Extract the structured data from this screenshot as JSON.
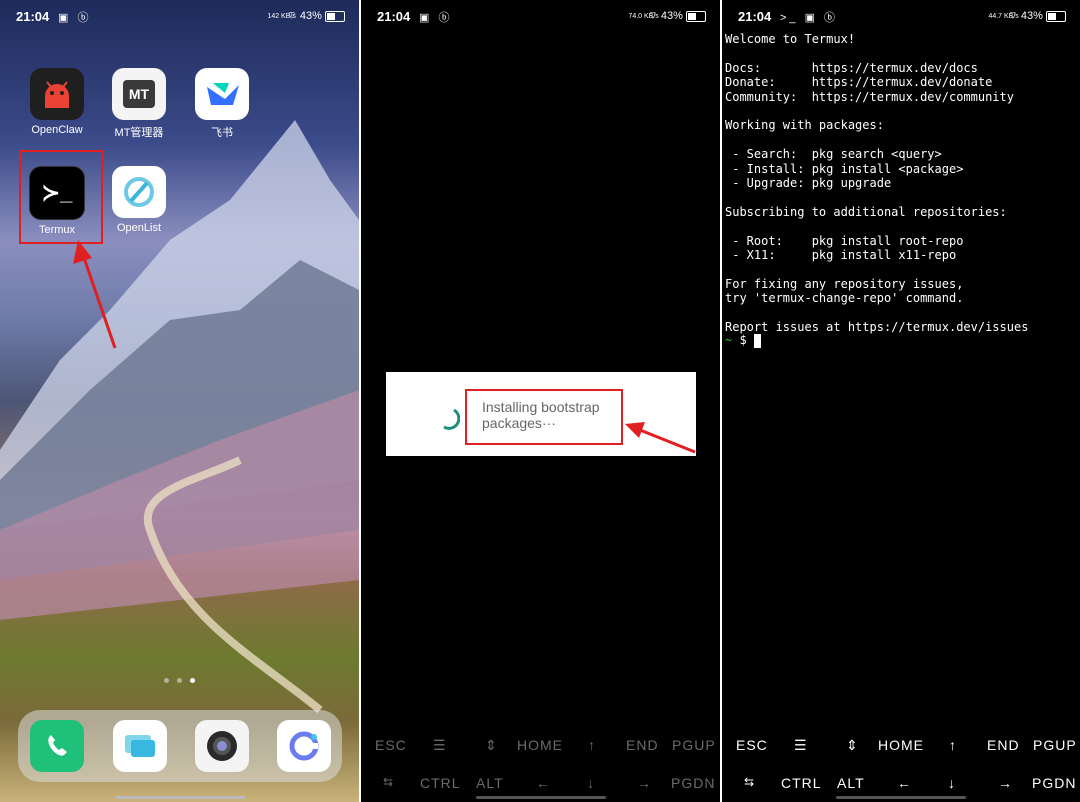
{
  "panel1": {
    "status": {
      "time": "21:04",
      "left_icons": "▣ ⓑ",
      "speed": "142 KB/s",
      "battery_pct": "43%"
    },
    "apps": [
      {
        "label": "OpenClaw",
        "icon": "android-robot-icon",
        "color": "#ea4335"
      },
      {
        "label": "MT管理器",
        "icon_text": "MT",
        "icon": "mt-manager-icon"
      },
      {
        "label": "飞书",
        "icon": "feishu-icon"
      },
      {
        "label": "Termux",
        "icon_text": "≻_",
        "icon": "terminal-icon"
      },
      {
        "label": "OpenList",
        "icon": "openlist-icon"
      }
    ],
    "page_dots": 3,
    "dock": [
      "phone-icon",
      "messages-icon",
      "camera-icon",
      "browser-icon"
    ]
  },
  "panel2": {
    "status": {
      "time": "21:04",
      "left_icons": "▣ ⓑ",
      "speed": "74.0 KB/s",
      "battery_pct": "43%"
    },
    "dialog_message": "Installing bootstrap packages···",
    "keys_row1": [
      "ESC",
      "☰",
      "⇕",
      "HOME",
      "↑",
      "END",
      "PGUP"
    ],
    "keys_row2": [
      "⇆",
      "CTRL",
      "ALT",
      "←",
      "↓",
      "→",
      "PGDN"
    ]
  },
  "panel3": {
    "status": {
      "time": "21:04",
      "left_icons": ">_ ▣ ⓑ",
      "speed": "44.7 KB/s",
      "battery_pct": "43%"
    },
    "terminal_output": "Welcome to Termux!\n\nDocs:       https://termux.dev/docs\nDonate:     https://termux.dev/donate\nCommunity:  https://termux.dev/community\n\nWorking with packages:\n\n - Search:  pkg search <query>\n - Install: pkg install <package>\n - Upgrade: pkg upgrade\n\nSubscribing to additional repositories:\n\n - Root:    pkg install root-repo\n - X11:     pkg install x11-repo\n\nFor fixing any repository issues,\ntry 'termux-change-repo' command.\n\nReport issues at https://termux.dev/issues",
    "prompt_tilde": "~",
    "prompt_symbol": "$",
    "keys_row1": [
      "ESC",
      "☰",
      "⇕",
      "HOME",
      "↑",
      "END",
      "PGUP"
    ],
    "keys_row2": [
      "⇆",
      "CTRL",
      "ALT",
      "←",
      "↓",
      "→",
      "PGDN"
    ]
  },
  "colors": {
    "highlight": "#e02020",
    "termux_green": "#2dc11a",
    "spinner": "#1a8f7a"
  }
}
